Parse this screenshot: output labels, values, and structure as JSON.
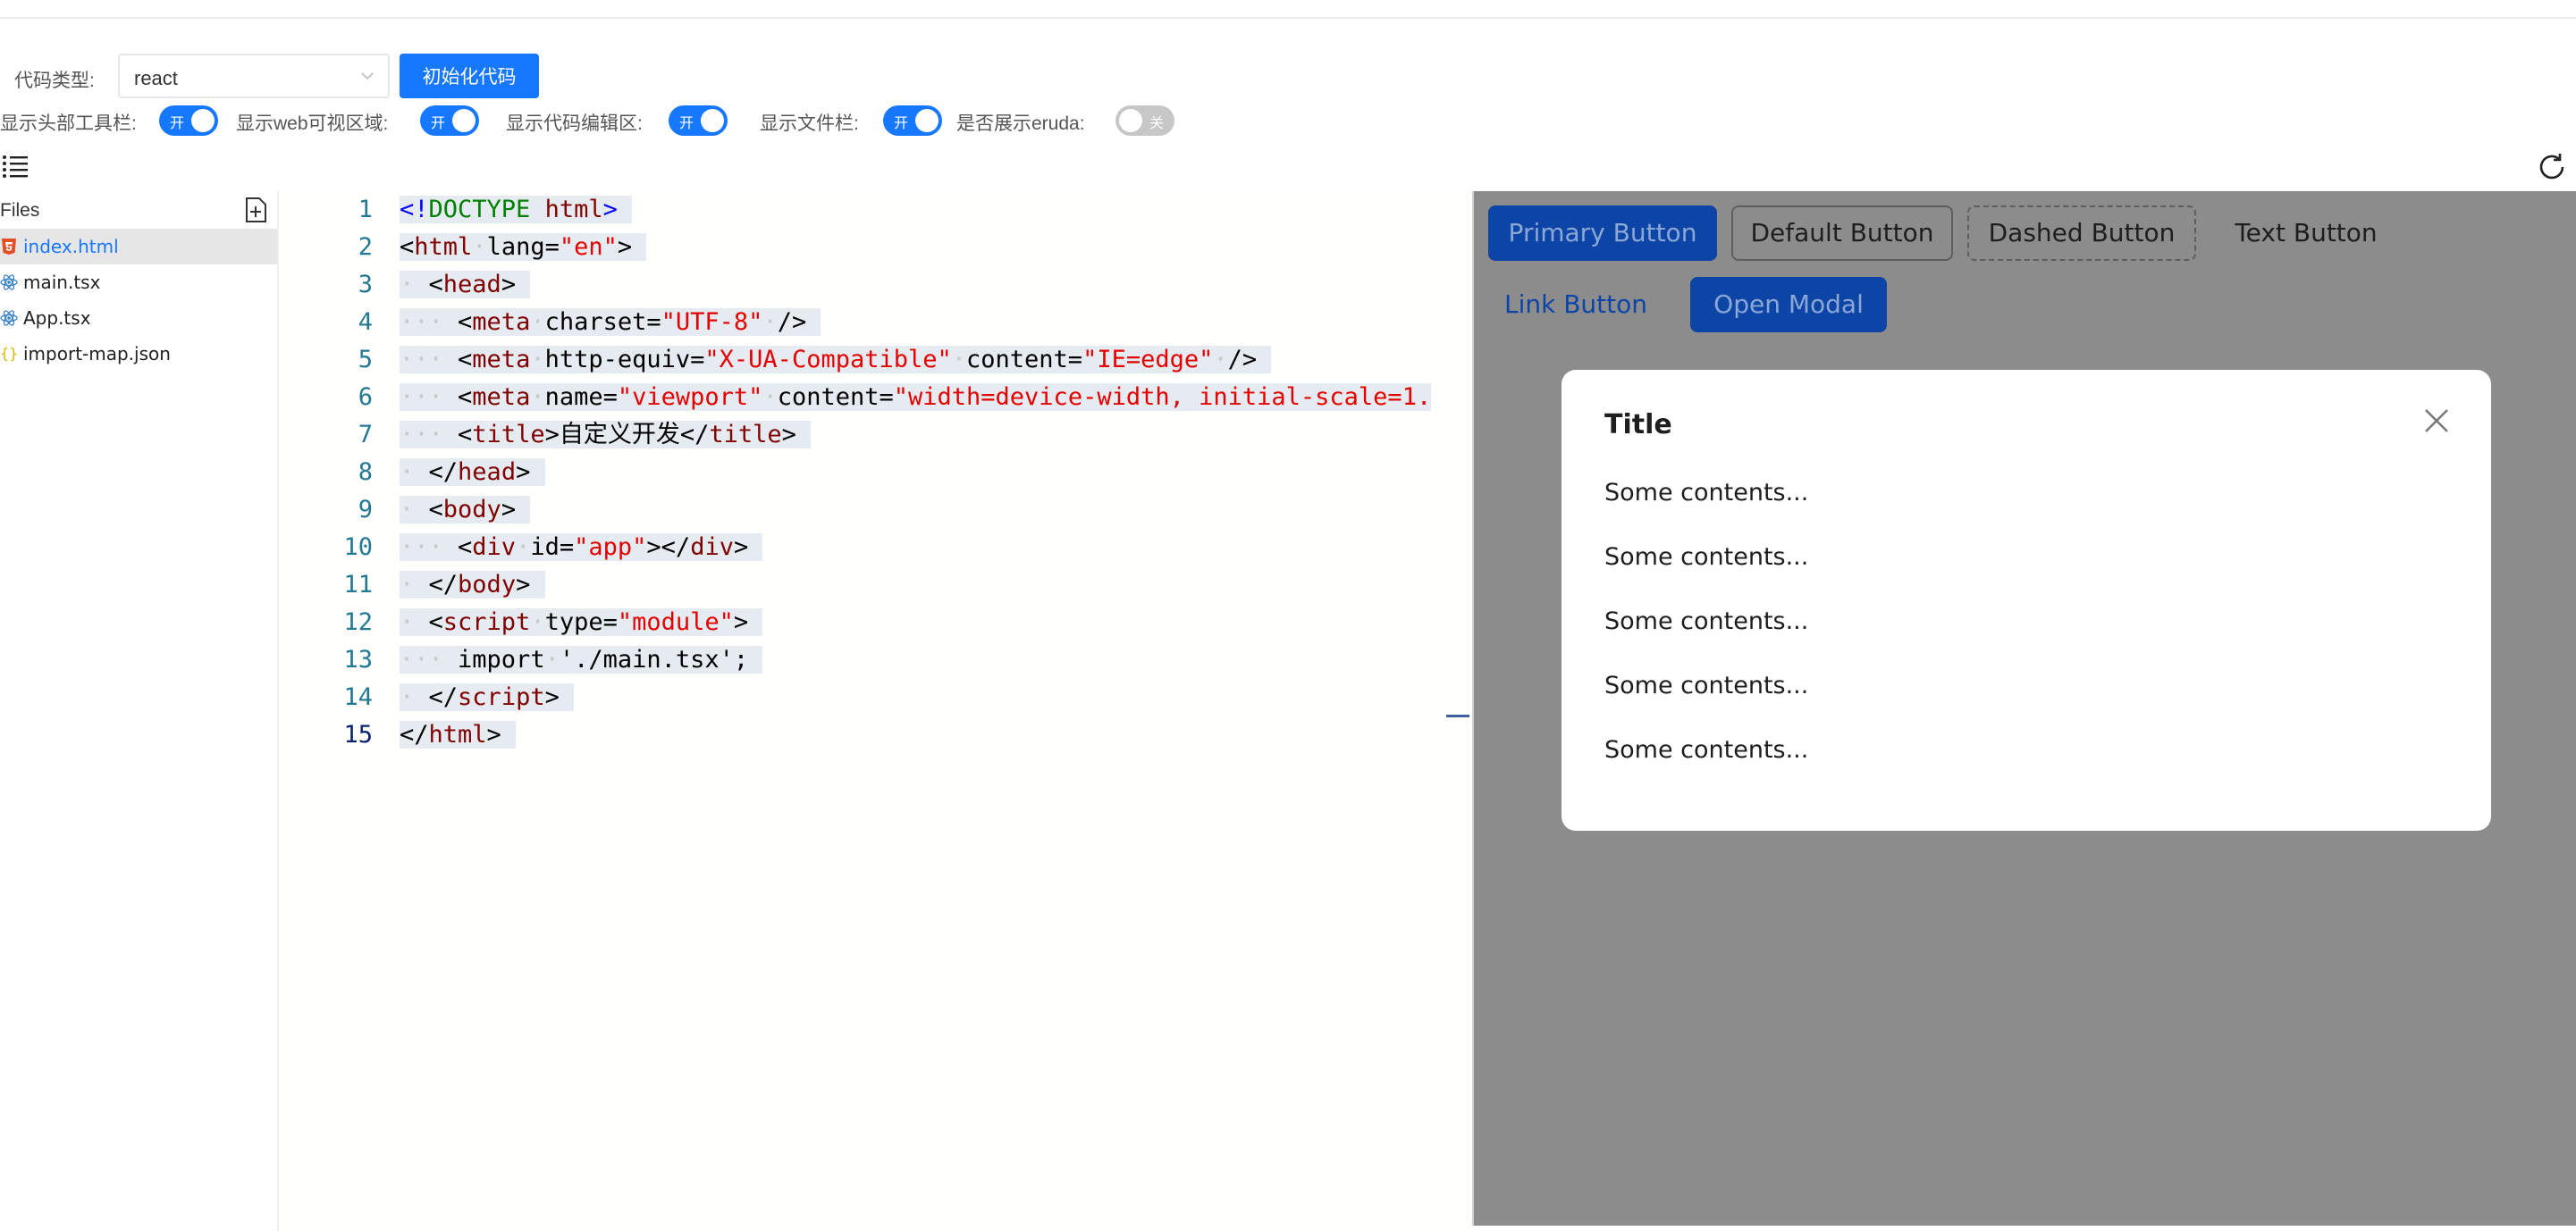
{
  "toolbar": {
    "code_type_label": "代码类型:",
    "code_type_value": "react",
    "init_button": "初始化代码",
    "switches": [
      {
        "label": "显示头部工具栏:",
        "state": "开",
        "on": true
      },
      {
        "label": "显示web可视区域:",
        "state": "开",
        "on": true
      },
      {
        "label": "显示代码编辑区:",
        "state": "开",
        "on": true
      },
      {
        "label": "显示文件栏:",
        "state": "开",
        "on": true
      },
      {
        "label": "是否展示eruda:",
        "state": "关",
        "on": false
      }
    ]
  },
  "files": {
    "title": "Files",
    "items": [
      {
        "name": "index.html",
        "icon": "html5-icon",
        "active": true
      },
      {
        "name": "main.tsx",
        "icon": "react-icon",
        "active": false
      },
      {
        "name": "App.tsx",
        "icon": "react-icon",
        "active": false
      },
      {
        "name": "import-map.json",
        "icon": "json-braces-icon",
        "active": false
      }
    ]
  },
  "editor": {
    "line_numbers": [
      "1",
      "2",
      "3",
      "4",
      "5",
      "6",
      "7",
      "8",
      "9",
      "10",
      "11",
      "12",
      "13",
      "14",
      "15"
    ],
    "current_line": "15"
  },
  "preview": {
    "buttons": {
      "primary": "Primary Button",
      "default": "Default Button",
      "dashed": "Dashed Button",
      "text": "Text Button",
      "link": "Link Button",
      "open_modal": "Open Modal"
    },
    "modal": {
      "title": "Title",
      "contents": [
        "Some contents...",
        "Some contents...",
        "Some contents...",
        "Some contents...",
        "Some contents..."
      ]
    }
  },
  "colors": {
    "accent": "#1677ff",
    "preview_overlay": "#8c8c8c",
    "primary_dimmed": "#0c45a6"
  }
}
